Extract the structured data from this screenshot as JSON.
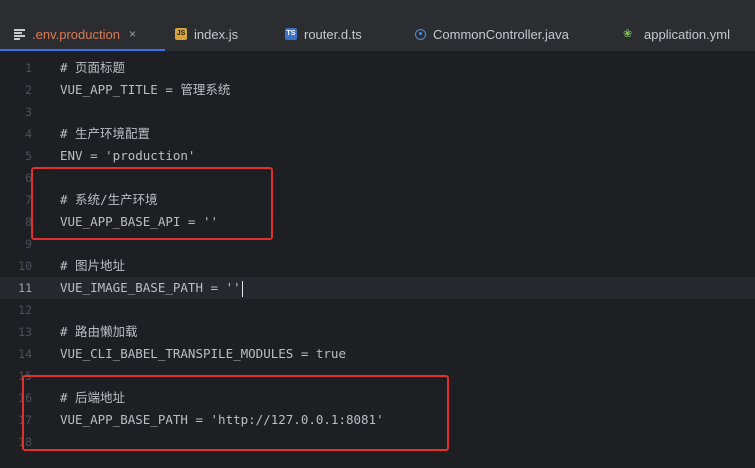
{
  "tabs": [
    {
      "label": ".env.production",
      "icon": "env-file-icon",
      "active": true,
      "close": "×"
    },
    {
      "label": "index.js",
      "icon": "js-file-icon",
      "badge": "JS"
    },
    {
      "label": "router.d.ts",
      "icon": "ts-file-icon",
      "badge": "TS"
    },
    {
      "label": "CommonController.java",
      "icon": "java-class-icon"
    },
    {
      "label": "application.yml",
      "icon": "yml-file-icon"
    }
  ],
  "editor": {
    "current_line": 11,
    "lines": [
      {
        "n": "1",
        "text": "# 页面标题"
      },
      {
        "n": "2",
        "text": "VUE_APP_TITLE = 管理系统"
      },
      {
        "n": "3",
        "text": ""
      },
      {
        "n": "4",
        "text": "# 生产环境配置"
      },
      {
        "n": "5",
        "text": "ENV = 'production'"
      },
      {
        "n": "6",
        "text": ""
      },
      {
        "n": "7",
        "text": "# 系统/生产环境"
      },
      {
        "n": "8",
        "text": "VUE_APP_BASE_API = ''"
      },
      {
        "n": "9",
        "text": ""
      },
      {
        "n": "10",
        "text": "# 图片地址"
      },
      {
        "n": "11",
        "text": "VUE_IMAGE_BASE_PATH = ''"
      },
      {
        "n": "12",
        "text": ""
      },
      {
        "n": "13",
        "text": "# 路由懒加载"
      },
      {
        "n": "14",
        "text": "VUE_CLI_BABEL_TRANSPILE_MODULES = true"
      },
      {
        "n": "15",
        "text": ""
      },
      {
        "n": "16",
        "text": "# 后端地址"
      },
      {
        "n": "17",
        "text": "VUE_APP_BASE_PATH = 'http://127.0.0.1:8081'"
      },
      {
        "n": "18",
        "text": ""
      }
    ]
  },
  "colors": {
    "highlight_box": "#e0302d",
    "active_tab_text": "#d87a55",
    "tab_underline": "#3574f0"
  }
}
